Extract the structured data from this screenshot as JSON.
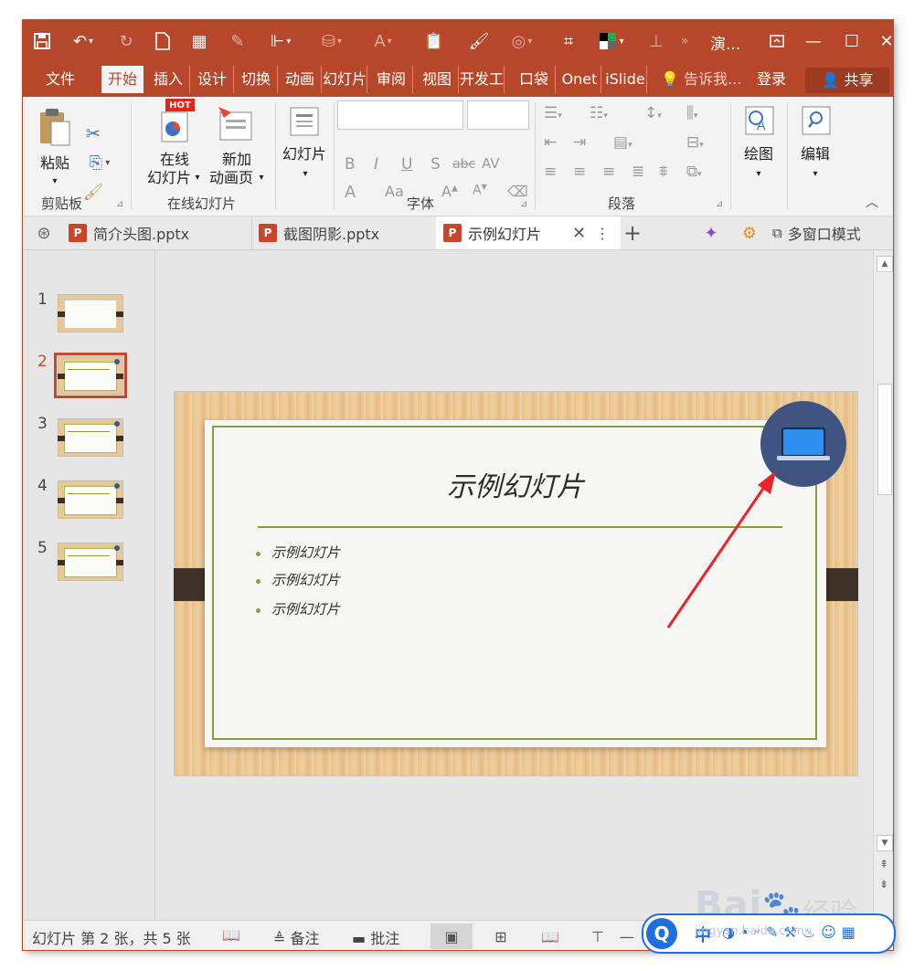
{
  "titlebar": {
    "title": "演...",
    "accent": "#b7472a"
  },
  "tabs": [
    "文件",
    "开始",
    "插入",
    "设计",
    "切换",
    "动画",
    "幻灯片",
    "审阅",
    "视图",
    "开发工具",
    "口袋",
    "Onet",
    "iSlide"
  ],
  "tabs_active_index": 1,
  "tell_me": "告诉我...",
  "login": "登录",
  "share": "共享",
  "ribbon": {
    "paste": "粘贴",
    "clipboard_group": "剪贴板",
    "online_slide_line1": "在线",
    "online_slide_line2": "幻灯片",
    "new_anim_line1": "新加",
    "new_anim_line2": "动画页",
    "online_group": "在线幻灯片",
    "hot_badge": "HOT",
    "slides_btn": "幻灯片",
    "font_group": "字体",
    "para_group": "段落",
    "draw": "绘图",
    "edit": "编辑",
    "font_b": "B",
    "font_i": "I",
    "font_u": "U",
    "font_s": "S",
    "font_abc": "abc",
    "font_av": "AV",
    "font_a": "A",
    "font_aa": "Aa"
  },
  "doc_tabs": [
    {
      "label": "简介头图.pptx",
      "active": false
    },
    {
      "label": "截图阴影.pptx",
      "active": false
    },
    {
      "label": "示例幻灯片",
      "active": true
    }
  ],
  "multiwindow": "多窗口模式",
  "thumbnails": [
    {
      "num": "1"
    },
    {
      "num": "2"
    },
    {
      "num": "3"
    },
    {
      "num": "4"
    },
    {
      "num": "5"
    }
  ],
  "active_slide": 2,
  "slide": {
    "title": "示例幻灯片",
    "bullets": [
      "示例幻灯片",
      "示例幻灯片",
      "示例幻灯片"
    ]
  },
  "status": {
    "slide_info": "幻灯片 第 2 张，共 5 张",
    "notes": "备注",
    "comments": "批注"
  },
  "watermark": {
    "logo": "Bai",
    "logo_tail": "经验",
    "url": "jingyan.baidu.com",
    "q": "Q",
    "zh": "中"
  }
}
